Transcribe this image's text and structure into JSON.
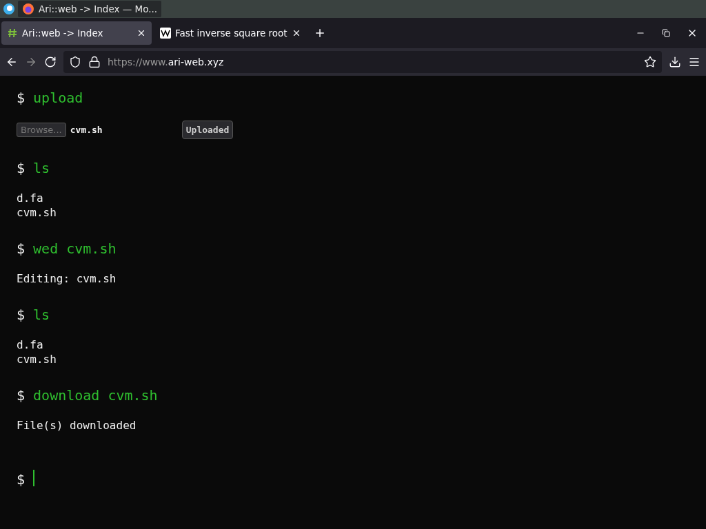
{
  "taskbar": {
    "window_title": "Ari::web -> Index — Mo..."
  },
  "tabs": [
    {
      "label": "Ari::web -> Index",
      "selected": true,
      "kind": "hash"
    },
    {
      "label": "Fast inverse square root",
      "selected": false,
      "kind": "wiki"
    }
  ],
  "address_bar": {
    "scheme": "https://www.",
    "domain": "ari-web.xyz"
  },
  "terminal": [
    {
      "kind": "command",
      "prompt": "$",
      "text": "upload"
    },
    {
      "kind": "upload",
      "browse": "Browse...",
      "browse_disabled": true,
      "file": "cvm.sh",
      "status": "Uploaded"
    },
    {
      "kind": "command",
      "prompt": "$",
      "text": "ls"
    },
    {
      "kind": "output",
      "lines": [
        "d.fa",
        "cvm.sh"
      ]
    },
    {
      "kind": "command",
      "prompt": "$",
      "text": "wed cvm.sh"
    },
    {
      "kind": "output",
      "lines": [
        "Editing: cvm.sh"
      ]
    },
    {
      "kind": "command",
      "prompt": "$",
      "text": "ls"
    },
    {
      "kind": "output",
      "lines": [
        "d.fa",
        "cvm.sh"
      ]
    },
    {
      "kind": "command",
      "prompt": "$",
      "text": "download cvm.sh"
    },
    {
      "kind": "output",
      "lines": [
        "File(s) downloaded"
      ]
    },
    {
      "kind": "input",
      "prompt": "$"
    }
  ]
}
